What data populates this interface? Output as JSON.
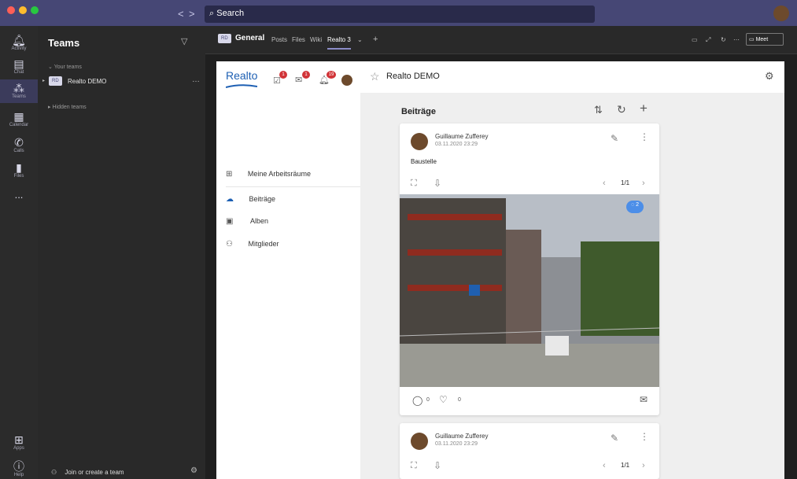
{
  "topbar": {
    "search_placeholder": "Search",
    "nav_back": "<",
    "nav_forward": ">"
  },
  "rail": {
    "items": [
      {
        "label": "Activity",
        "icon": "bell-icon"
      },
      {
        "label": "Chat",
        "icon": "chat-icon"
      },
      {
        "label": "Teams",
        "icon": "teams-icon"
      },
      {
        "label": "Calendar",
        "icon": "calendar-icon"
      },
      {
        "label": "Calls",
        "icon": "phone-icon"
      },
      {
        "label": "Files",
        "icon": "file-icon"
      },
      {
        "label": "...",
        "icon": "ellipsis-icon"
      }
    ],
    "apps_label": "Apps",
    "help_label": "Help"
  },
  "teams_panel": {
    "title": "Teams",
    "your_teams": "Your teams",
    "team_initials": "RD",
    "team_name": "Realto DEMO",
    "hidden_teams": "Hidden teams",
    "join_label": "Join or create a team"
  },
  "channel_bar": {
    "initials": "RD",
    "title": "General",
    "tabs": [
      "Posts",
      "Files",
      "Wiki",
      "Realto 3"
    ],
    "meet_label": "Meet"
  },
  "left_app": {
    "logo": "Realto",
    "badges": {
      "tasks": "1",
      "mail": "1",
      "notifications": "19"
    },
    "menu": [
      {
        "label": "Meine Arbeitsräume",
        "icon": "grid-icon"
      },
      {
        "label": "Beiträge",
        "icon": "cloud-icon"
      },
      {
        "label": "Alben",
        "icon": "album-icon"
      },
      {
        "label": "Mitglieder",
        "icon": "members-icon"
      }
    ]
  },
  "right_app": {
    "title": "Realto DEMO",
    "section_title": "Beiträge",
    "posts": [
      {
        "author": "Guillaume Zufferey",
        "date": "03.11.2020 23:29",
        "title": "Baustelle",
        "page": "1/1",
        "comment_count": "0",
        "like_count": "0",
        "image_badge": "2"
      },
      {
        "author": "Guillaume Zufferey",
        "date": "03.11.2020 23:29",
        "page": "1/1"
      }
    ]
  }
}
